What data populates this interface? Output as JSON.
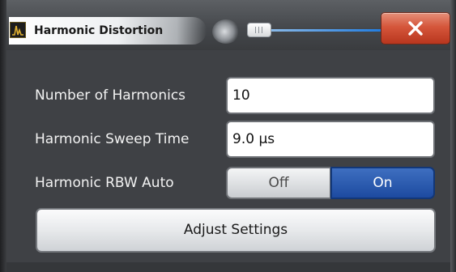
{
  "window": {
    "title": "Harmonic Distortion",
    "icon": "spectrum-app-icon",
    "close_icon": "close-x-icon"
  },
  "settings": {
    "number_of_harmonics": {
      "label": "Number of Harmonics",
      "value": "10"
    },
    "sweep_time": {
      "label": "Harmonic Sweep Time",
      "value": "9.0 µs"
    },
    "rbw_auto": {
      "label": "Harmonic RBW Auto",
      "off_label": "Off",
      "on_label": "On",
      "selected": "On"
    },
    "adjust_button": "Adjust Settings"
  },
  "colors": {
    "panel_background": "#3f4145",
    "toggle_active": "#2a5db4",
    "close_button": "#d5563b"
  }
}
